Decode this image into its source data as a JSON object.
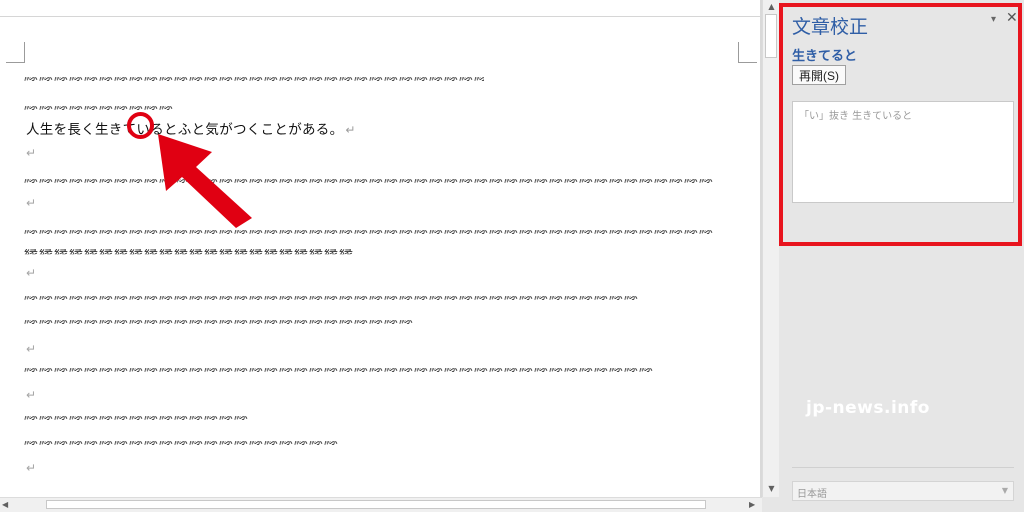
{
  "document": {
    "main_line": "人生を長く生きているとふと気がつくことがある。",
    "return_mark": "↵"
  },
  "pane": {
    "title": "文章校正",
    "menu_glyph": "▾",
    "close_glyph": "✕",
    "flagged_word": "生きてると",
    "resume_label": "再開(S)",
    "suggestion": "「い」抜き 生きていると",
    "language": "日本語",
    "watermark": "jp-news.info"
  },
  "colors": {
    "accent": "#2f5ea6",
    "highlight": "#e8141e"
  }
}
